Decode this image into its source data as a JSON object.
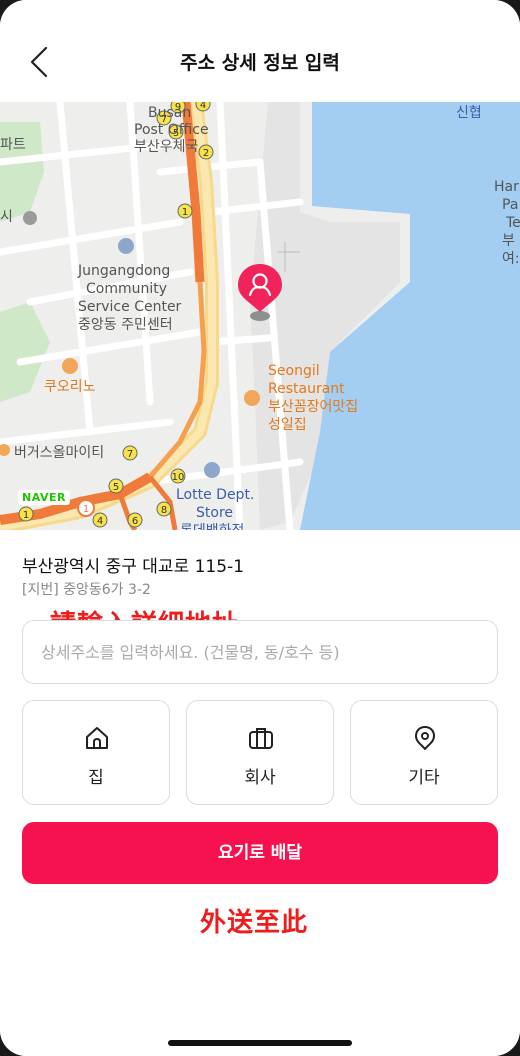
{
  "header": {
    "title": "주소 상세 정보 입력"
  },
  "map": {
    "labels": {
      "post_office_en_a": "Busan",
      "post_office_en_b": "Post Office",
      "post_office_ko": "부산우체국",
      "sinhyeop": "신협",
      "left_apt": "파트",
      "left_si": "시",
      "center_en_1": "Jungangdong",
      "center_en_2": "Community",
      "center_en_3": "Service Center",
      "center_ko": "중앙동 주민센터",
      "right_1": "Har",
      "right_2": "Pa",
      "right_3": "Te",
      "right_4": "부",
      "right_5": "여:",
      "kuorino": "쿠오리노",
      "seongil_1": "Seongil",
      "seongil_2": "Restaurant",
      "seongil_3": "부산꼼장어맛집",
      "seongil_4": "성일집",
      "burger": "버거스올마이티",
      "lotte_1": "Lotte Dept.",
      "lotte_2": "Store",
      "lotte_3": "롯데백화점"
    },
    "naver_logo": "NAVER",
    "pin_color": "#f0245a",
    "water_color": "#a4cdf2"
  },
  "address": {
    "road": "부산광역시 중구 대교로 115-1",
    "jibun": "[지번] 중앙동6가 3-2"
  },
  "annotations": {
    "input_hint": "請輸入詳細地址",
    "deliver_hint": "外送至此"
  },
  "detail_input": {
    "placeholder": "상세주소를 입력하세요. (건물명, 동/호수 등)",
    "value": ""
  },
  "type_buttons": [
    {
      "label": "집",
      "icon": "home-icon"
    },
    {
      "label": "회사",
      "icon": "briefcase-icon"
    },
    {
      "label": "기타",
      "icon": "location-pin-icon"
    }
  ],
  "deliver_button": {
    "label": "요기로 배달",
    "color": "#f5124e"
  }
}
